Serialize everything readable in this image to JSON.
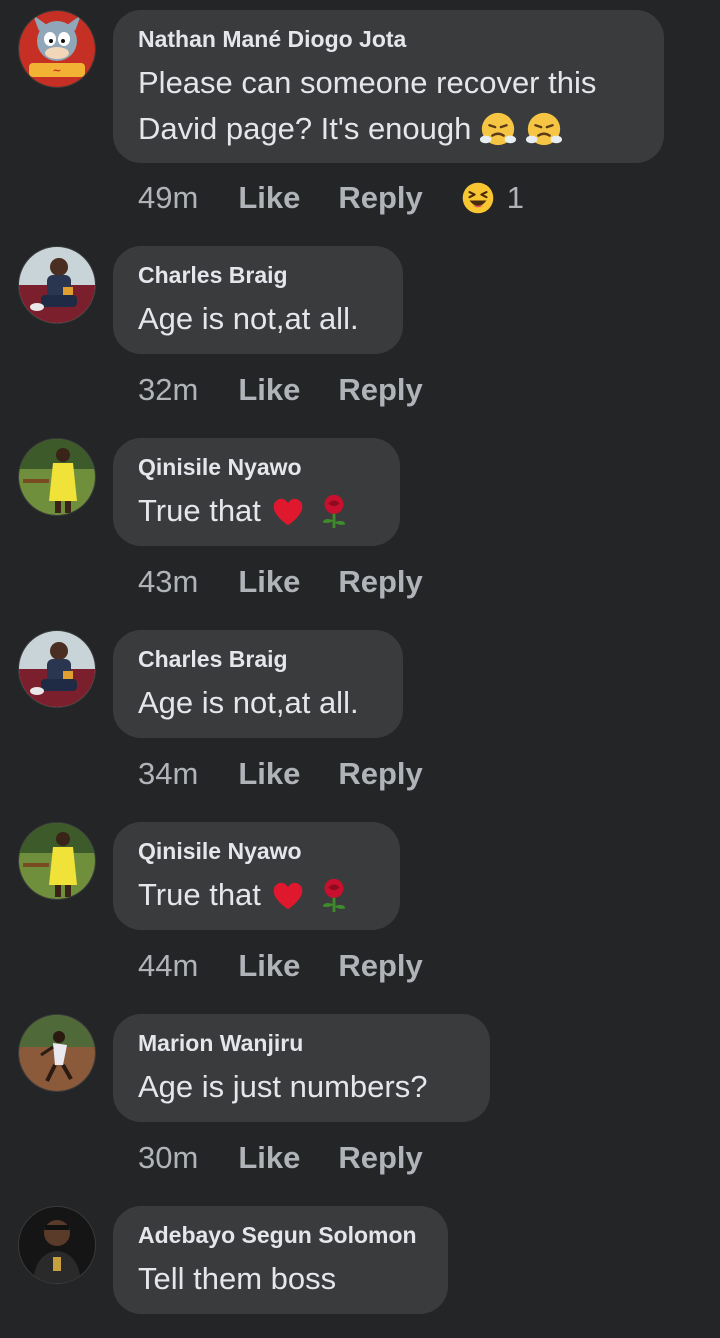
{
  "comments": [
    {
      "author": "Nathan Mané Diogo Jota",
      "text_line1": "Please can someone recover this",
      "text_line2": "David page? It's enough",
      "emojis": [
        "steam-face-icon",
        "steam-face-icon"
      ],
      "time": "49m",
      "like": "Like",
      "reply": "Reply",
      "reaction_icon": "laughing-face-icon",
      "reaction_count": "1",
      "avatar": "cartoon-cat-avatar"
    },
    {
      "author": "Charles Braig",
      "text": "Age is not,at all.",
      "time": "32m",
      "like": "Like",
      "reply": "Reply",
      "avatar": "man-sitting-avatar"
    },
    {
      "author": "Qinisile Nyawo",
      "text": "True that",
      "emojis": [
        "red-heart-icon",
        "rose-icon"
      ],
      "time": "43m",
      "like": "Like",
      "reply": "Reply",
      "avatar": "woman-yellow-dress-avatar"
    },
    {
      "author": "Charles Braig",
      "text": "Age is not,at all.",
      "time": "34m",
      "like": "Like",
      "reply": "Reply",
      "avatar": "man-sitting-avatar"
    },
    {
      "author": "Qinisile Nyawo",
      "text": "True that",
      "emojis": [
        "red-heart-icon",
        "rose-icon"
      ],
      "time": "44m",
      "like": "Like",
      "reply": "Reply",
      "avatar": "woman-yellow-dress-avatar"
    },
    {
      "author": "Marion Wanjiru",
      "text": "Age is just numbers?",
      "time": "30m",
      "like": "Like",
      "reply": "Reply",
      "avatar": "outdoor-dance-avatar"
    },
    {
      "author": "Adebayo Segun Solomon",
      "text": "Tell them boss",
      "avatar": "man-portrait-avatar"
    }
  ],
  "colors": {
    "background": "#242527",
    "bubble": "#3a3b3c",
    "primary_text": "#e4e6eb",
    "secondary_text": "#b0b3b8"
  }
}
